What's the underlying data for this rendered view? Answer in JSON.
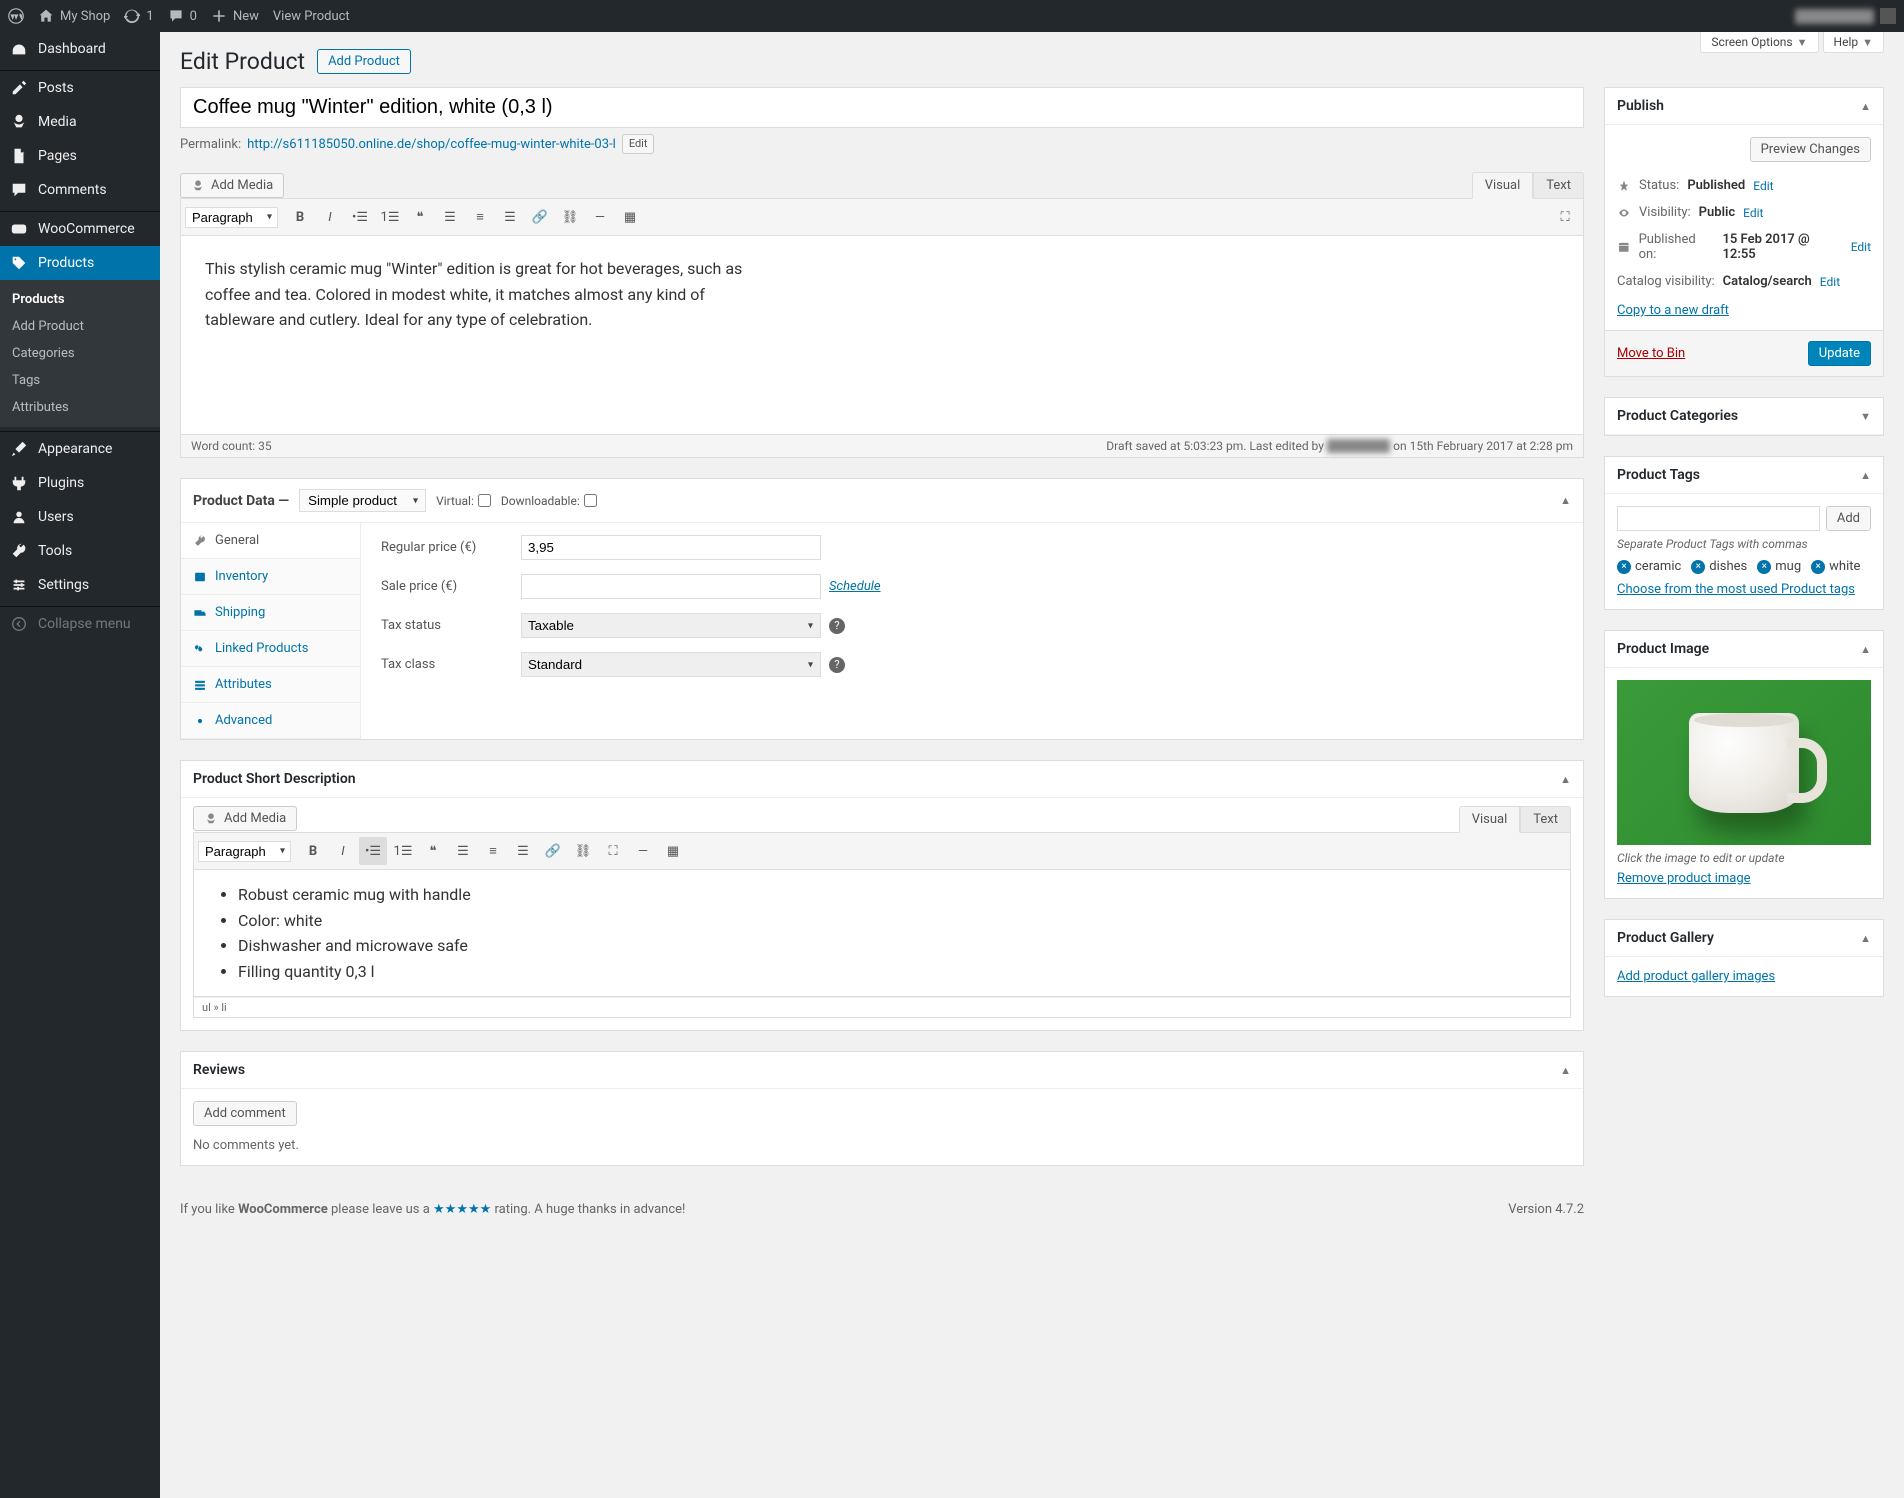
{
  "adminbar": {
    "site_name": "My Shop",
    "updates": "1",
    "comments": "0",
    "new": "New",
    "view": "View Product"
  },
  "sidebar": {
    "items": [
      {
        "icon": "dashboard",
        "label": "Dashboard"
      },
      {
        "icon": "pin",
        "label": "Posts"
      },
      {
        "icon": "media",
        "label": "Media"
      },
      {
        "icon": "page",
        "label": "Pages"
      },
      {
        "icon": "comment",
        "label": "Comments"
      },
      {
        "icon": "woo",
        "label": "WooCommerce"
      },
      {
        "icon": "tag",
        "label": "Products"
      },
      {
        "icon": "brush",
        "label": "Appearance"
      },
      {
        "icon": "plugin",
        "label": "Plugins"
      },
      {
        "icon": "user",
        "label": "Users"
      },
      {
        "icon": "wrench",
        "label": "Tools"
      },
      {
        "icon": "gear",
        "label": "Settings"
      },
      {
        "icon": "collapse",
        "label": "Collapse menu"
      }
    ],
    "submenu": [
      "Products",
      "Add Product",
      "Categories",
      "Tags",
      "Attributes"
    ]
  },
  "top_tabs": {
    "screen_options": "Screen Options",
    "help": "Help"
  },
  "heading": {
    "title": "Edit Product",
    "add_btn": "Add Product"
  },
  "product": {
    "title": "Coffee mug \"Winter\" edition, white (0,3 l)",
    "permalink_label": "Permalink:",
    "permalink_base": "http://s611185050.online.de/shop/",
    "permalink_slug": "coffee-mug-winter-white-03-l",
    "edit_btn": "Edit",
    "description": "This stylish ceramic mug \"Winter\" edition is great for hot beverages, such as coffee and tea. Colored in modest white, it matches almost any kind of tableware and cutlery. Ideal for any type of celebration."
  },
  "editor": {
    "add_media": "Add Media",
    "visual": "Visual",
    "text": "Text",
    "paragraph": "Paragraph",
    "word_count": "Word count: 35",
    "draft_saved": "Draft saved at 5:03:23 pm. Last edited by",
    "draft_saved_on": "on 15th February 2017 at 2:28 pm"
  },
  "product_data": {
    "title": "Product Data",
    "type": "Simple product",
    "virtual": "Virtual:",
    "downloadable": "Downloadable:",
    "tabs": [
      "General",
      "Inventory",
      "Shipping",
      "Linked Products",
      "Attributes",
      "Advanced"
    ],
    "fields": {
      "regular_price": "Regular price (€)",
      "regular_price_val": "3,95",
      "sale_price": "Sale price (€)",
      "schedule": "Schedule",
      "tax_status": "Tax status",
      "tax_status_val": "Taxable",
      "tax_class": "Tax class",
      "tax_class_val": "Standard"
    }
  },
  "short_desc": {
    "title": "Product Short Description",
    "items": [
      "Robust ceramic mug with handle",
      "Color: white",
      "Dishwasher and microwave safe",
      "Filling quantity 0,3 l"
    ],
    "path": "ul » li"
  },
  "reviews": {
    "title": "Reviews",
    "add_comment": "Add comment",
    "no_comments": "No comments yet."
  },
  "publish": {
    "title": "Publish",
    "preview": "Preview Changes",
    "status_label": "Status:",
    "status_val": "Published",
    "visibility_label": "Visibility:",
    "visibility_val": "Public",
    "published_label": "Published on:",
    "published_val": "15 Feb 2017 @ 12:55",
    "catalog_label": "Catalog visibility:",
    "catalog_val": "Catalog/search",
    "edit": "Edit",
    "copy": "Copy to a new draft",
    "trash": "Move to Bin",
    "update": "Update"
  },
  "categories": {
    "title": "Product Categories"
  },
  "tags": {
    "title": "Product Tags",
    "add": "Add",
    "separate": "Separate Product Tags with commas",
    "list": [
      "ceramic",
      "dishes",
      "mug",
      "white"
    ],
    "choose": "Choose from the most used Product tags"
  },
  "image_box": {
    "title": "Product Image",
    "hint": "Click the image to edit or update",
    "remove": "Remove product image"
  },
  "gallery": {
    "title": "Product Gallery",
    "add": "Add product gallery images"
  },
  "footer": {
    "like": "If you like",
    "woo": "WooCommerce",
    "please": "please leave us a",
    "rating": "rating. A huge thanks in advance!",
    "version": "Version 4.7.2"
  }
}
